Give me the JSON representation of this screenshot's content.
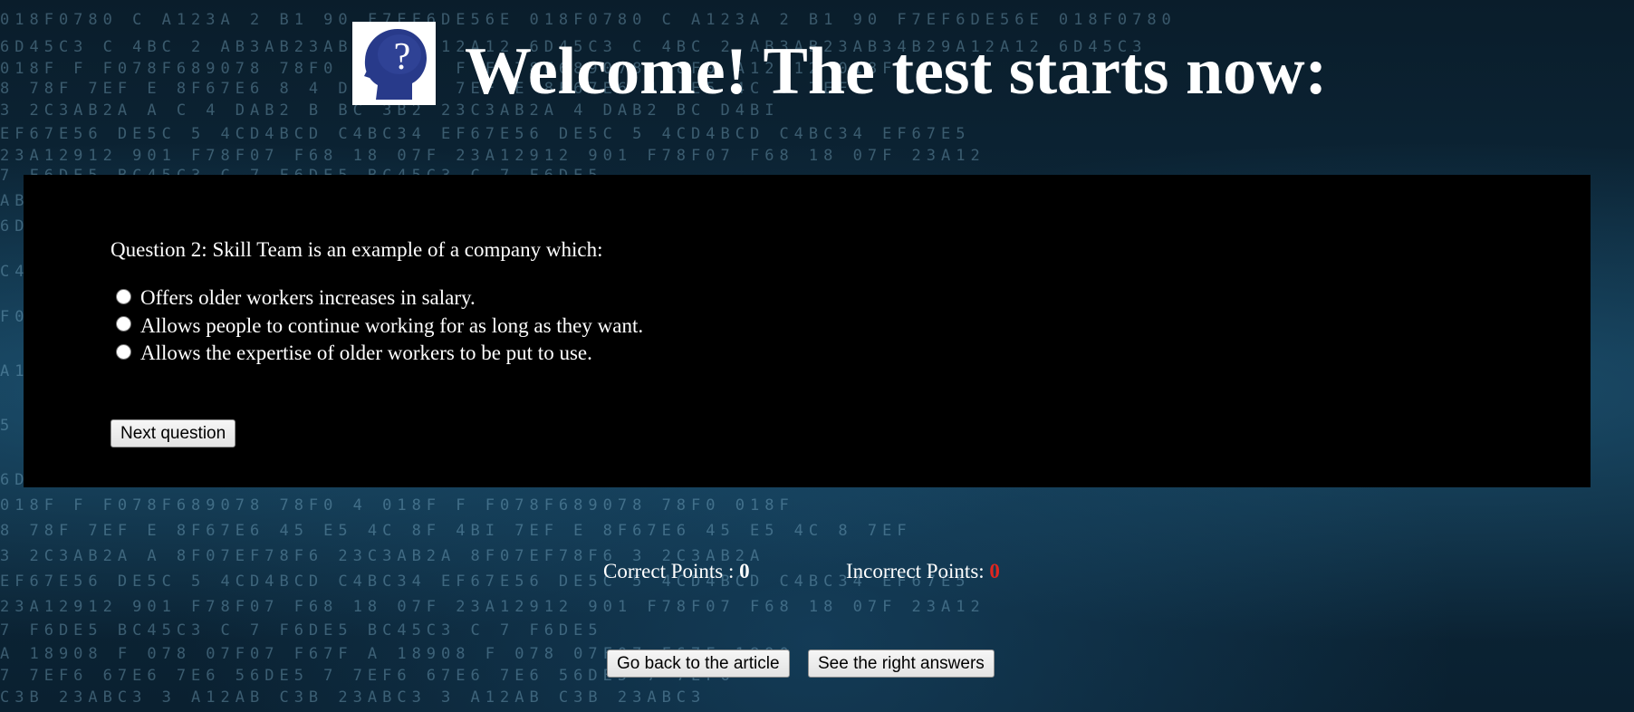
{
  "header": {
    "title": "Welcome! The test starts now:",
    "logo_icon": "head-question-mark-icon",
    "logo_glyph": "?"
  },
  "quiz": {
    "question": "Question 2: Skill Team is an example of a company which:",
    "options": [
      "Offers older workers increases in salary.",
      "Allows people to continue working for as long as they want.",
      "Allows the expertise of older workers to be put to use."
    ],
    "next_button": "Next question"
  },
  "score": {
    "correct_label": "Correct Points : ",
    "correct_value": "0",
    "incorrect_label": "Incorrect Points: ",
    "incorrect_value": "0"
  },
  "footer": {
    "back_button": "Go back to the article",
    "answers_button": "See the right answers"
  },
  "colors": {
    "panel_bg": "#000000",
    "incorrect_value": "#e0261f",
    "text": "#ffffff"
  }
}
